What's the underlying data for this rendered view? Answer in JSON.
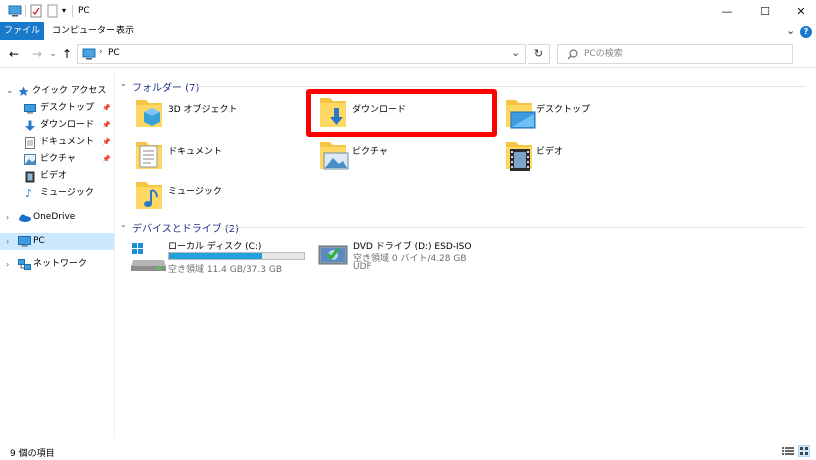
{
  "window": {
    "title": "PC",
    "minimize": "—",
    "maximize": "☐",
    "close": "✕",
    "qa_dropdown": "▾"
  },
  "ribbon": {
    "tabs": [
      "ファイル",
      "コンピューター",
      "表示"
    ],
    "expand": "⌄",
    "help": "?"
  },
  "nav": {
    "back": "←",
    "forward": "→",
    "history": "⌄",
    "up": "↑",
    "path_sep": "›",
    "path": "PC",
    "addr_dropdown": "⌄",
    "refresh": "↻",
    "search_placeholder": "PCの検索"
  },
  "sidebar": {
    "quick_access": "クイック アクセス",
    "pinned": [
      {
        "label": "デスクトップ",
        "icon": "desktop-icon",
        "pin": "📌"
      },
      {
        "label": "ダウンロード",
        "icon": "download-icon",
        "pin": "📌"
      },
      {
        "label": "ドキュメント",
        "icon": "document-icon",
        "pin": "📌"
      },
      {
        "label": "ピクチャ",
        "icon": "picture-icon",
        "pin": "📌"
      }
    ],
    "others": [
      {
        "label": "ビデオ",
        "icon": "video-icon"
      },
      {
        "label": "ミュージック",
        "icon": "music-icon"
      }
    ],
    "onedrive": "OneDrive",
    "pc": "PC",
    "network": "ネットワーク"
  },
  "content": {
    "folders_header": "フォルダー (7)",
    "folders": [
      {
        "name": "3D オブジェクト",
        "icon": "3d-objects-folder-icon"
      },
      {
        "name": "ダウンロード",
        "icon": "downloads-folder-icon"
      },
      {
        "name": "デスクトップ",
        "icon": "desktop-folder-icon"
      },
      {
        "name": "ドキュメント",
        "icon": "documents-folder-icon"
      },
      {
        "name": "ピクチャ",
        "icon": "pictures-folder-icon"
      },
      {
        "name": "ビデオ",
        "icon": "videos-folder-icon"
      },
      {
        "name": "ミュージック",
        "icon": "music-folder-icon"
      }
    ],
    "drives_header": "デバイスとドライブ (2)",
    "drives": [
      {
        "name": "ローカル ディスク (C:)",
        "detail": "空き領域 11.4 GB/37.3 GB",
        "used_fraction": 0.69,
        "icon": "local-disk-icon"
      },
      {
        "name": "DVD ドライブ (D:) ESD-ISO",
        "detail": "空き領域 0 バイト/4.28 GB",
        "extra": "UDF",
        "icon": "dvd-drive-icon"
      }
    ]
  },
  "status": {
    "item_count": "9 個の項目"
  },
  "colors": {
    "accent": "#1979ca",
    "highlight": "#ff0000",
    "selected_bg": "#cce8ff",
    "drive_bar": "#26a0da"
  }
}
